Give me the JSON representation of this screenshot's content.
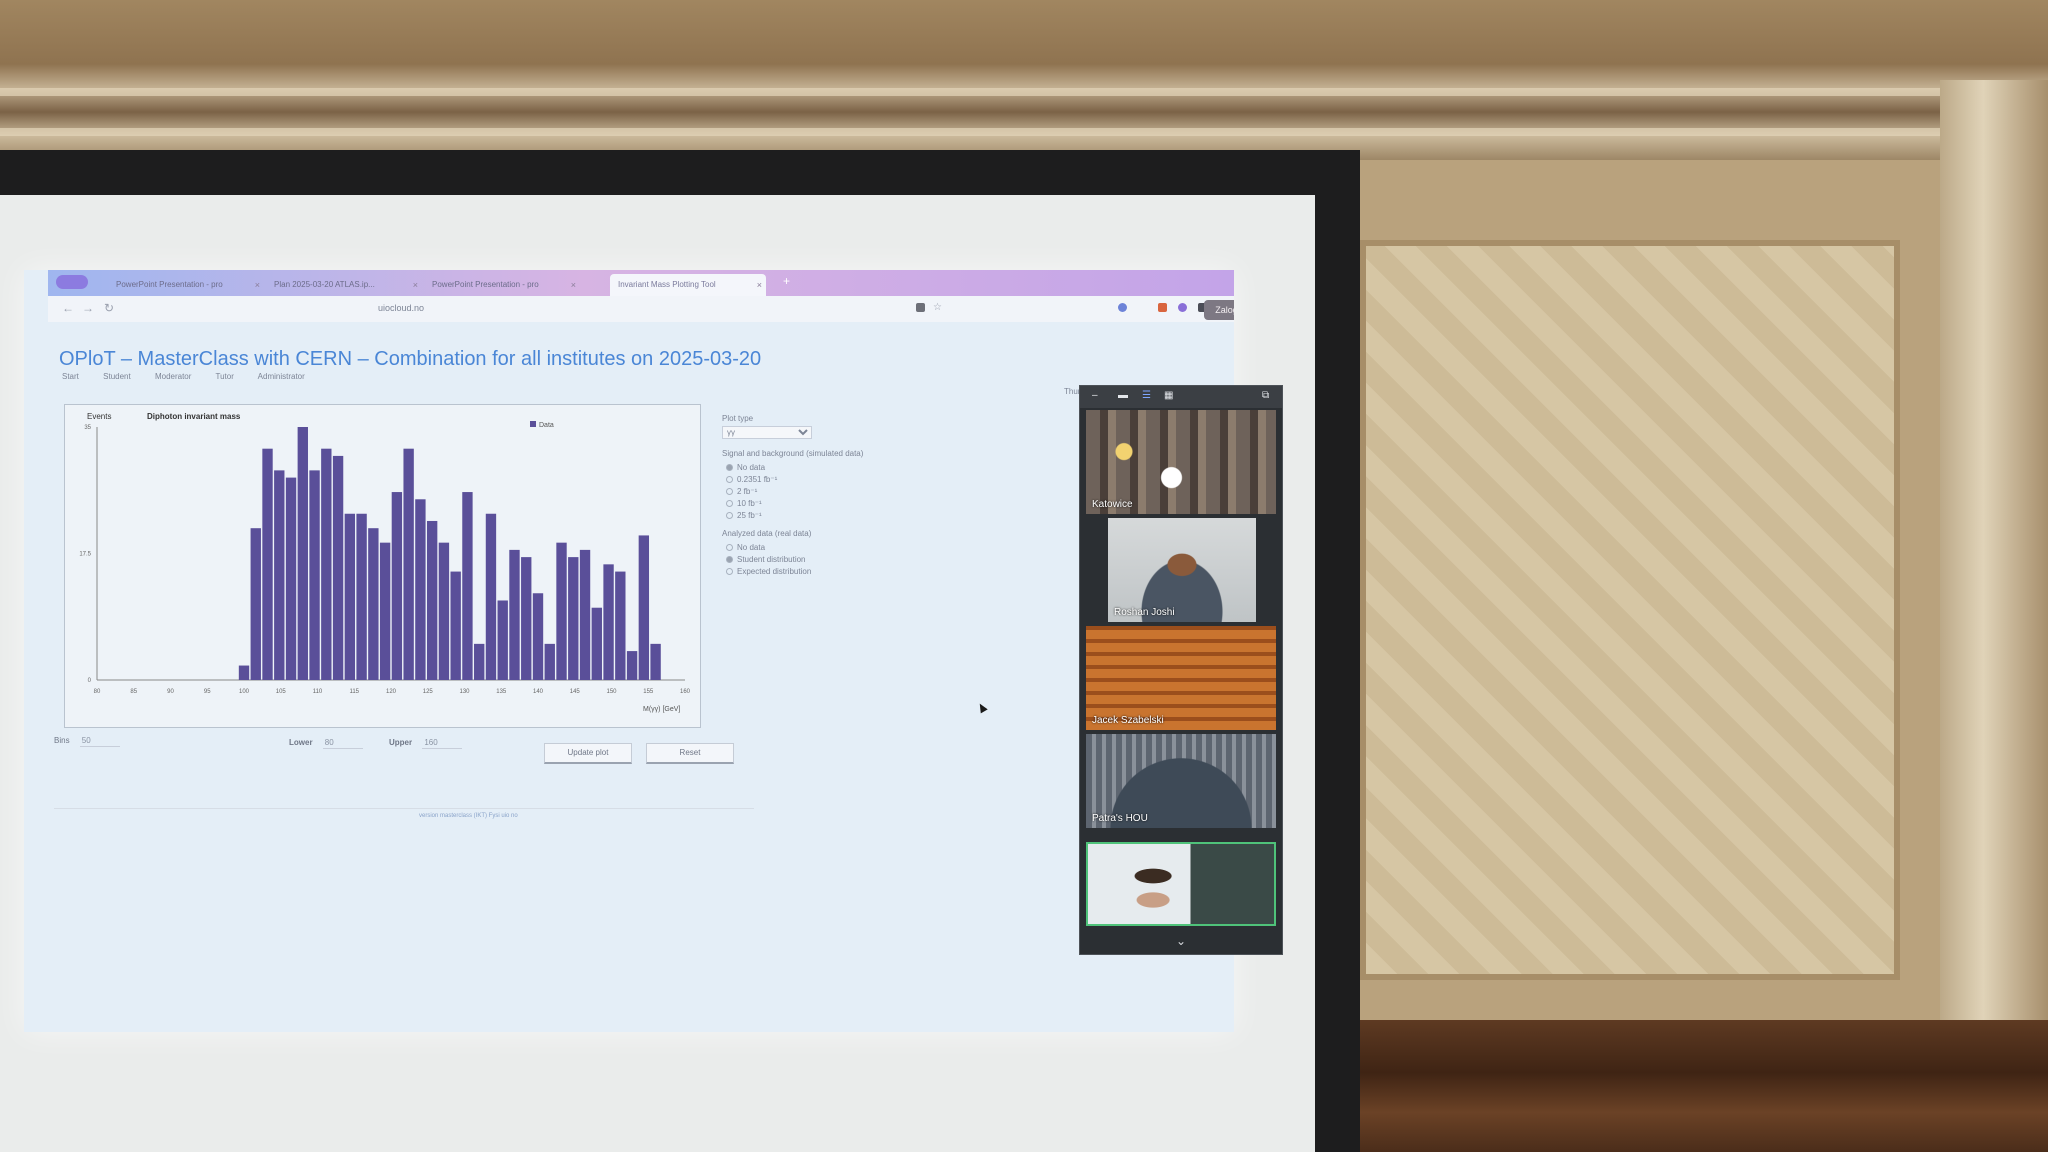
{
  "browser": {
    "tabs": [
      {
        "label": "PowerPoint Presentation - pro",
        "active": false
      },
      {
        "label": "Plan 2025-03-20 ATLAS.ip...",
        "active": false
      },
      {
        "label": "PowerPoint Presentation - pro",
        "active": false
      },
      {
        "label": "Invariant Mass Plotting Tool",
        "active": true
      }
    ],
    "url": "uiocloud.no",
    "login_label": "Zaloguj się",
    "icons": [
      "back-icon",
      "forward-icon",
      "reload-icon",
      "star-icon",
      "extensions-icon"
    ]
  },
  "page": {
    "title": "OPloT – MasterClass with CERN – Combination for all institutes on 2025-03-20",
    "nav": [
      "Start",
      "Student",
      "Moderator",
      "Tutor",
      "Administrator"
    ],
    "corner_text": "Thurs",
    "footer": "version masterclass (IKT) Fysi uio no"
  },
  "chart_data": {
    "type": "bar",
    "title": "Diphoton invariant mass",
    "ylabel": "Events",
    "xlabel": "M(γγ) [GeV]",
    "legend": [
      "Data"
    ],
    "legend_position": "top-right",
    "xlim": [
      80,
      160
    ],
    "ylim": [
      0,
      35
    ],
    "yticks": [
      0,
      17.5,
      35
    ],
    "xticks": [
      80,
      85,
      90,
      95,
      100,
      105,
      110,
      115,
      120,
      125,
      130,
      135,
      140,
      145,
      150,
      155,
      160
    ],
    "bin_width": 1.6,
    "bins_start": [
      99.2,
      100.8,
      102.4,
      104.0,
      105.6,
      107.2,
      108.8,
      110.4,
      112.0,
      113.6,
      115.2,
      116.8,
      118.4,
      120.0,
      121.6,
      123.2,
      124.8,
      126.4,
      128.0,
      129.6,
      131.2,
      132.8,
      134.4,
      136.0,
      137.6,
      139.2,
      140.8,
      142.4,
      144.0,
      145.6,
      147.2,
      148.8,
      150.4,
      152.0,
      153.6,
      155.2,
      156.8,
      158.4
    ],
    "values": [
      2,
      21,
      32,
      29,
      28,
      35,
      29,
      32,
      31,
      23,
      23,
      21,
      19,
      26,
      32,
      25,
      22,
      19,
      15,
      26,
      5,
      23,
      11,
      18,
      17,
      12,
      5,
      19,
      17,
      18,
      10,
      16,
      15,
      4,
      20,
      5,
      0,
      0
    ],
    "bar_color": "#5a4f99"
  },
  "settings": {
    "plot_type_label": "Plot type",
    "plot_type_value": "γγ",
    "signal_label": "Signal and background (simulated data)",
    "signal_options": [
      "No data",
      "0.2351 fb⁻¹",
      "2 fb⁻¹",
      "10 fb⁻¹",
      "25 fb⁻¹"
    ],
    "signal_selected": 0,
    "analyzed_label": "Analyzed data (real data)",
    "analyzed_options": [
      "No data",
      "Student distribution",
      "Expected distribution"
    ],
    "analyzed_selected": 1
  },
  "controls": {
    "bins_label": "Bins",
    "bins_value": "50",
    "lower_label": "Lower",
    "lower_value": "80",
    "upper_label": "Upper",
    "upper_value": "160",
    "update_label": "Update plot",
    "reset_label": "Reset"
  },
  "video": {
    "participants": [
      "Katowice",
      "Roshan Joshi",
      "Jacek Szabelski",
      "Patra's HOU",
      ""
    ]
  }
}
